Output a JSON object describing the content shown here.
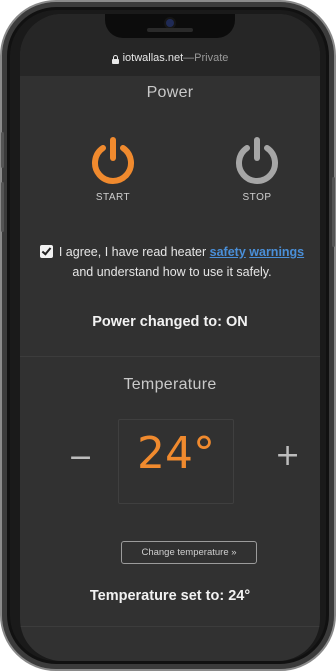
{
  "browser": {
    "url": "iotwallas.net",
    "separator": " — ",
    "mode": "Private"
  },
  "power": {
    "title": "Power",
    "start_label": "START",
    "stop_label": "STOP",
    "start_color": "#f08a2e",
    "stop_color": "#a6a6a6"
  },
  "agreement": {
    "checked": true,
    "text_before": "I agree, I have read heater ",
    "link_text_1": "safety",
    "link_text_2": "warnings",
    "text_after": " and understand how to use it safely."
  },
  "power_status": "Power changed to: ON",
  "temperature": {
    "title": "Temperature",
    "value": "24°",
    "minus": "−",
    "plus": "+",
    "change_button": "Change temperature »",
    "status": "Temperature set to: 24°",
    "value_color": "#f08a2e"
  }
}
